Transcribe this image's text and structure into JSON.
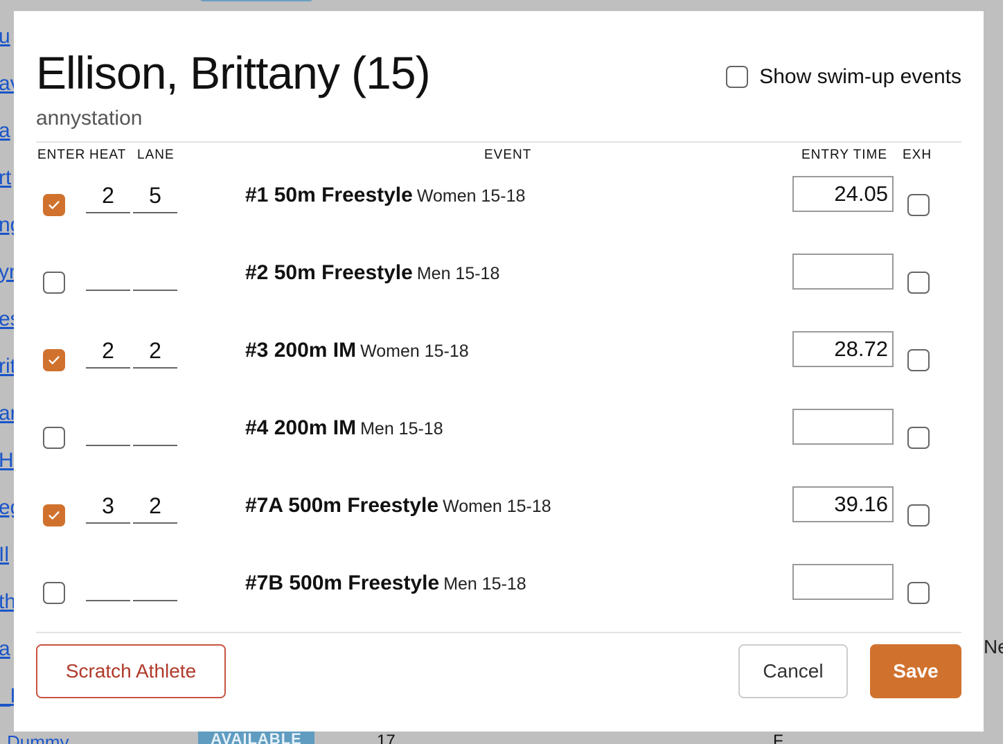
{
  "background": {
    "link_fragments": [
      "u",
      "av",
      "a",
      "rt",
      "ng",
      "yn",
      "es",
      "rit",
      "ar",
      "H",
      "eg",
      "Il",
      "th",
      "a",
      "_H"
    ],
    "bottom_row": {
      "name": "Dummy",
      "badge": "AVAILABLE",
      "number": "17",
      "gender": "F"
    },
    "right_fragment": "Ne"
  },
  "modal": {
    "title": "Ellison, Brittany (15)",
    "subtitle": "annystation",
    "show_swimup_label": "Show swim-up events",
    "show_swimup_checked": false,
    "headers": {
      "enter": "ENTER",
      "heat": "HEAT",
      "lane": "LANE",
      "event": "EVENT",
      "entry_time": "ENTRY TIME",
      "exh": "EXH"
    },
    "rows": [
      {
        "entered": true,
        "heat": "2",
        "lane": "5",
        "event": "#1 50m Freestyle",
        "group": "Women 15-18",
        "entry_time": "24.05",
        "exh": false
      },
      {
        "entered": false,
        "heat": "",
        "lane": "",
        "event": "#2 50m Freestyle",
        "group": "Men 15-18",
        "entry_time": "",
        "exh": false
      },
      {
        "entered": true,
        "heat": "2",
        "lane": "2",
        "event": "#3 200m IM",
        "group": "Women 15-18",
        "entry_time": "28.72",
        "exh": false
      },
      {
        "entered": false,
        "heat": "",
        "lane": "",
        "event": "#4 200m IM",
        "group": "Men 15-18",
        "entry_time": "",
        "exh": false
      },
      {
        "entered": true,
        "heat": "3",
        "lane": "2",
        "event": "#7A 500m Freestyle",
        "group": "Women 15-18",
        "entry_time": "39.16",
        "exh": false
      },
      {
        "entered": false,
        "heat": "",
        "lane": "",
        "event": "#7B 500m Freestyle",
        "group": "Men 15-18",
        "entry_time": "",
        "exh": false
      }
    ],
    "buttons": {
      "scratch": "Scratch Athlete",
      "cancel": "Cancel",
      "save": "Save"
    },
    "colors": {
      "accent": "#d0722e",
      "danger": "#b0392a"
    }
  }
}
